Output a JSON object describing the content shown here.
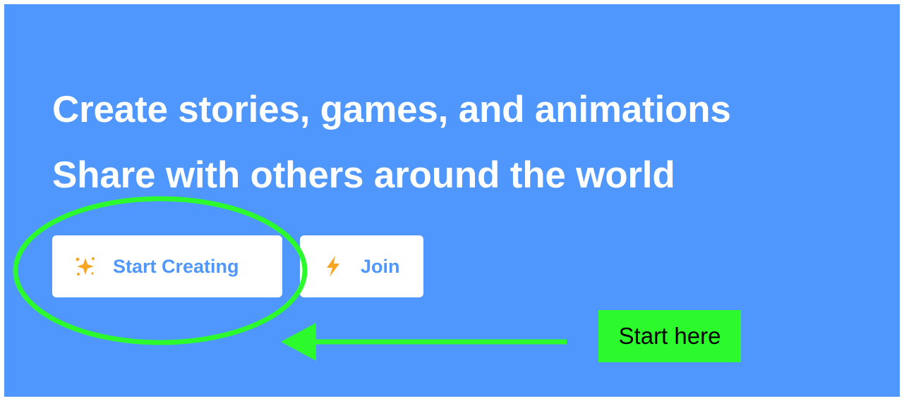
{
  "hero": {
    "line1": "Create stories, games, and animations",
    "line2": "Share with others around the world"
  },
  "buttons": {
    "start_creating": {
      "label": "Start Creating",
      "icon": "sparkles-icon"
    },
    "join": {
      "label": "Join",
      "icon": "lightning-bolt-icon"
    }
  },
  "annotation": {
    "note": "Start here",
    "highlight_color": "#2cfa2c"
  },
  "colors": {
    "background": "#4f97fd",
    "button_text": "#4f97fd",
    "icon": "#f6a623",
    "headline": "#ffffff"
  }
}
